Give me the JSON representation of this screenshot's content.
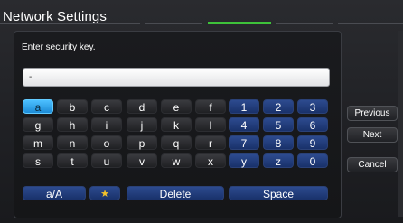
{
  "window": {
    "title": "Network Settings"
  },
  "colors": {
    "accent": "#3ec23a",
    "key_selected": "#2aa3ec",
    "key_blue": "#223e7c",
    "key_dark": "#2b2c30"
  },
  "prompt": "Enter security key.",
  "input": {
    "value": "-"
  },
  "keyboard": {
    "rows": [
      [
        "a",
        "b",
        "c",
        "d",
        "e",
        "f",
        "1",
        "2",
        "3"
      ],
      [
        "g",
        "h",
        "i",
        "j",
        "k",
        "l",
        "4",
        "5",
        "6"
      ],
      [
        "m",
        "n",
        "o",
        "p",
        "q",
        "r",
        "7",
        "8",
        "9"
      ],
      [
        "s",
        "t",
        "u",
        "v",
        "w",
        "x",
        "y",
        "z",
        "0"
      ]
    ],
    "case_label": "a/A",
    "special_icon": "star-icon",
    "star_glyph": "★",
    "delete_label": "Delete",
    "space_label": "Space"
  },
  "side_buttons": {
    "previous": "Previous",
    "next": "Next",
    "cancel": "Cancel"
  }
}
